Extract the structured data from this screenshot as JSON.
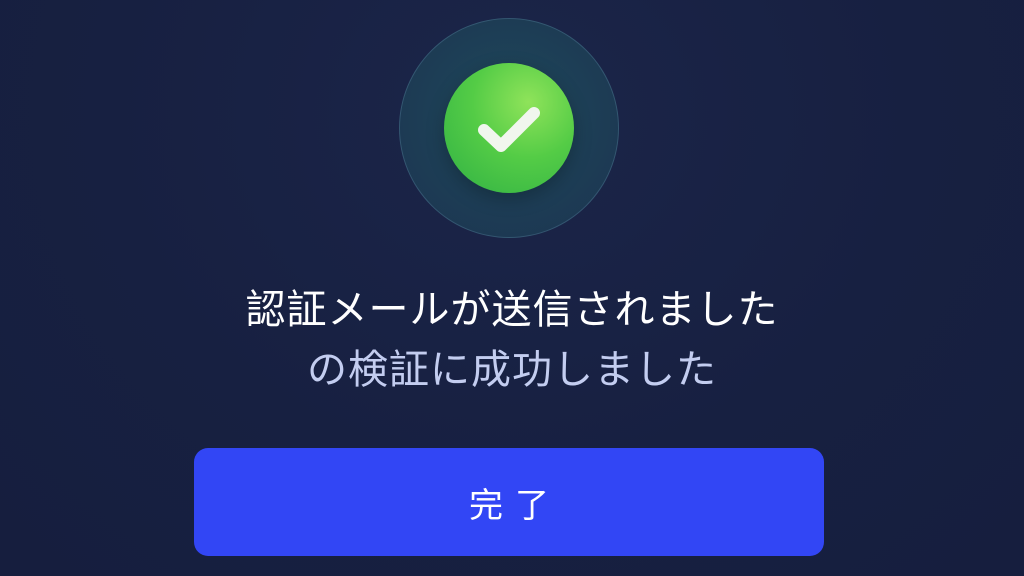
{
  "success_dialog": {
    "icon": "check-circle-icon",
    "title": "認証メールが送信されました",
    "subtitle": "の検証に成功しました",
    "done_button_label": "完了"
  },
  "colors": {
    "background": "#172041",
    "icon_green": "#54cc46",
    "button_blue": "#3246f5",
    "subtitle_text": "#c3cdf0"
  }
}
